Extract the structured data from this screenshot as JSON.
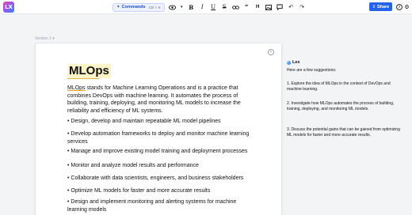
{
  "app": {
    "logo_text": "LX"
  },
  "toolbar": {
    "commands_label": "Commands",
    "commands_shortcut": "Ctrl + K",
    "bold_label": "B",
    "italic_label": "I",
    "underline_label": "U",
    "strike_label": "S",
    "heading_label": "H",
    "quote_label": "“"
  },
  "header_right": {
    "share_label": "Share"
  },
  "document": {
    "version_label": "Version 1",
    "title": "MLOps",
    "intro_term": "MLOps",
    "intro_rest": " stands for Machine Learning Operations and is a practice that combines DevOps with machine learning. It automates the process of building, training, deploying, and monitoring ML models to increase the reliability and efficiency of ML systems.",
    "bullets": [
      "• Design, develop and maintain repeatable ML model pipelines",
      "• Develop automation frameworks to deploy and monitor machine learning services",
      "• Manage and improve existing model training and deployment processes",
      "• Monitor and analyze model results and performance",
      "• Collaborate with data scientists, engineers, and business stakeholders",
      "• Optimize ML models for faster and more accurate results",
      "• Design and implement monitoring and alerting systems for machine learning models"
    ]
  },
  "assistant": {
    "name": "Lex",
    "intro": "Here are a few suggestions:",
    "suggestions": [
      "1. Explore the idea of MLOps in the context of DevOps and machine learning.",
      "2. Investigate how MLOps automates the process of building, training, deploying, and monitoring ML models.",
      "3. Discuss the potential gains that can be gained from optimizing ML models for faster and more accurate results."
    ]
  },
  "icons": {
    "commands": "sparkle-icon",
    "preview": "eye-icon",
    "link": "link-icon",
    "image": "image-icon",
    "comment": "comment-icon",
    "undo": "undo-icon",
    "redo": "redo-icon",
    "share": "share-icon",
    "help": "help-icon",
    "settings": "gear-icon"
  },
  "colors": {
    "accent": "#2563eb",
    "title_highlight": "#fef3c7"
  }
}
